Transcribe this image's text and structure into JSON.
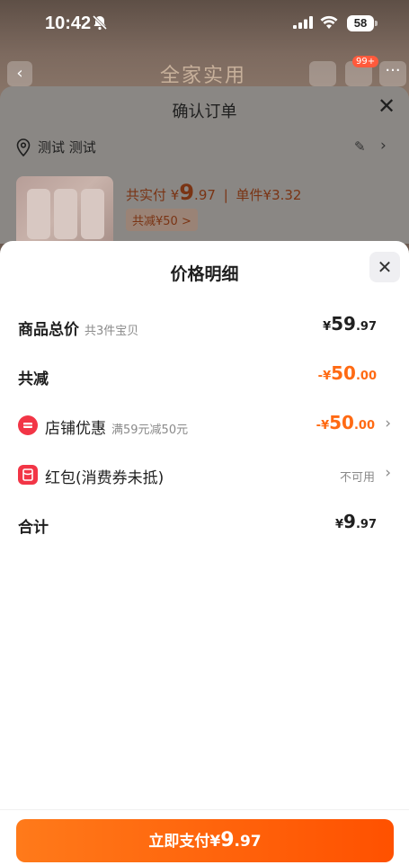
{
  "status": {
    "time": "10:42",
    "battery": "58"
  },
  "background_page": {
    "title": "全家实用",
    "cart_badge": "99+"
  },
  "order": {
    "title": "确认订单",
    "address": "测试 测试",
    "pay_label": "共实付",
    "pay_currency": "¥",
    "pay_int": "9",
    "pay_dec": ".97",
    "unit_label": "单件¥3.32",
    "discount_tag": "共减¥50 >"
  },
  "detail": {
    "title": "价格明细",
    "rows": [
      {
        "label": "商品总价",
        "sub": "共3件宝贝",
        "currency": "¥",
        "int": "59",
        "dec": ".97"
      },
      {
        "label": "共减",
        "currency": "-¥",
        "int": "50",
        "dec": ".00"
      },
      {
        "label": "店铺优惠",
        "sub": "满59元减50元",
        "currency": "-¥",
        "int": "50",
        "dec": ".00"
      },
      {
        "label": "红包(消费券未抵)",
        "status": "不可用"
      },
      {
        "label": "合计",
        "currency": "¥",
        "int": "9",
        "dec": ".97"
      }
    ]
  },
  "pay_button": {
    "label": "立即支付",
    "currency": "¥",
    "int": "9",
    "dec": ".97"
  },
  "colors": {
    "accent": "#ff6a13",
    "button": "#ff5a0a",
    "coupon_icon": "#f23546"
  }
}
